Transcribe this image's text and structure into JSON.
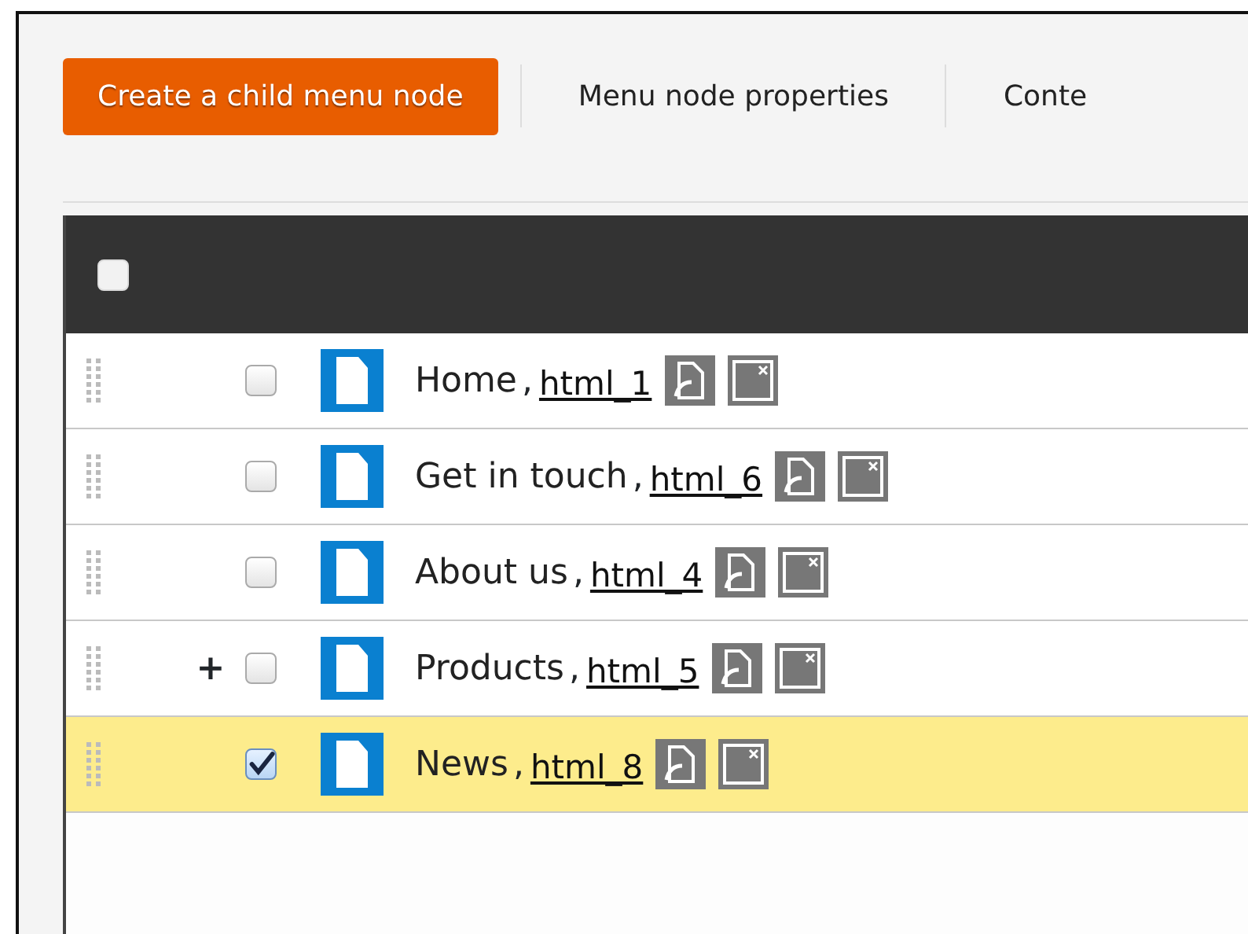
{
  "toolbar": [
    {
      "label": "Create a child menu node",
      "selected": true
    },
    {
      "label": "Menu node properties",
      "selected": false
    },
    {
      "label": "Conte",
      "selected": false
    }
  ],
  "header": {
    "select_all_checked": false
  },
  "rows": [
    {
      "checked": false,
      "selected": false,
      "title": "Home",
      "separator": ",",
      "link": "html_1"
    },
    {
      "checked": false,
      "selected": false,
      "title": "Get in touch",
      "separator": ",",
      "link": "html_6"
    },
    {
      "checked": false,
      "selected": false,
      "title": "About us",
      "separator": ",",
      "link": "html_4"
    },
    {
      "toggle": "+",
      "checked": false,
      "selected": false,
      "title": "Products",
      "separator": ",",
      "link": "html_5"
    },
    {
      "checked": true,
      "selected": true,
      "title": "News",
      "separator": ",",
      "link": "html_8"
    }
  ]
}
